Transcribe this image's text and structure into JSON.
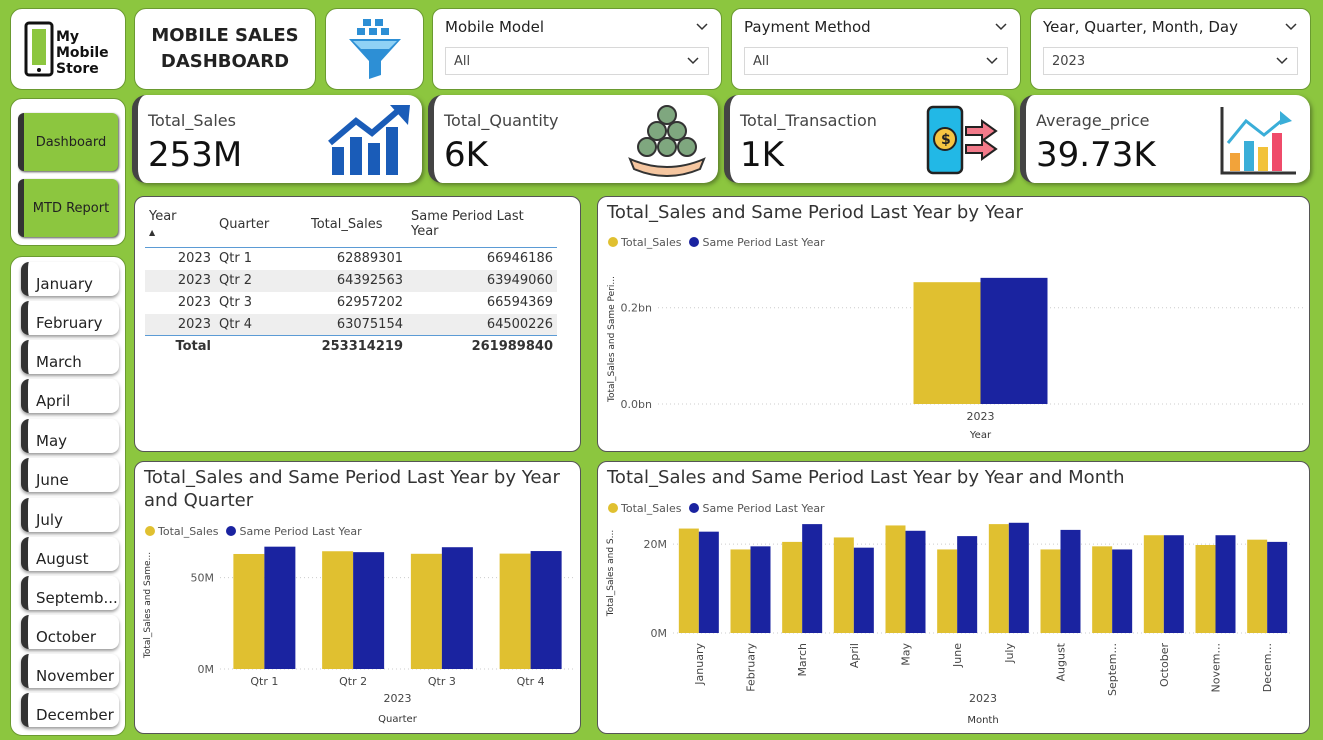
{
  "logo": {
    "line1": "My",
    "line2": "Mobile",
    "line3": "Store"
  },
  "title": {
    "line1": "MOBILE SALES",
    "line2": "DASHBOARD"
  },
  "slicers": [
    {
      "label": "Mobile Model",
      "value": "All"
    },
    {
      "label": "Payment Method",
      "value": "All"
    },
    {
      "label": "Year, Quarter, Month, Day",
      "value": "2023"
    }
  ],
  "nav": {
    "dashboard": "Dashboard",
    "mtd": "MTD Report"
  },
  "months": [
    "January",
    "February",
    "March",
    "April",
    "May",
    "June",
    "July",
    "August",
    "Septemb...",
    "October",
    "November",
    "December"
  ],
  "kpis": [
    {
      "label": "Total_Sales",
      "value": "253M",
      "icon": "growth-chart-icon"
    },
    {
      "label": "Total_Quantity",
      "value": "6K",
      "icon": "coins-hand-icon"
    },
    {
      "label": "Total_Transaction",
      "value": "1K",
      "icon": "mobile-payment-icon"
    },
    {
      "label": "Average_price",
      "value": "39.73K",
      "icon": "bar-chart-icon"
    }
  ],
  "matrix": {
    "headers": [
      "Year",
      "Quarter",
      "Total_Sales",
      "Same Period Last Year"
    ],
    "rows": [
      {
        "year": "2023",
        "quarter": "Qtr 1",
        "sales": "62889301",
        "last": "66946186"
      },
      {
        "year": "2023",
        "quarter": "Qtr 2",
        "sales": "64392563",
        "last": "63949060"
      },
      {
        "year": "2023",
        "quarter": "Qtr 3",
        "sales": "62957202",
        "last": "66594369"
      },
      {
        "year": "2023",
        "quarter": "Qtr 4",
        "sales": "63075154",
        "last": "64500226"
      }
    ],
    "total": {
      "label": "Total",
      "sales": "253314219",
      "last": "261989840"
    }
  },
  "colors": {
    "sales": "#e0c030",
    "last": "#1a23a0",
    "bg": "#8cc63f"
  },
  "chart_data": [
    {
      "type": "bar",
      "title": "Total_Sales and Same Period Last Year by Year",
      "legend": [
        "Total_Sales",
        "Same Period Last Year"
      ],
      "xlabel": "Year",
      "ylabel": "Total_Sales and Same Peri...",
      "categories": [
        "2023"
      ],
      "series": [
        {
          "name": "Total_Sales",
          "values": [
            0.253
          ]
        },
        {
          "name": "Same Period Last Year",
          "values": [
            0.262
          ]
        }
      ],
      "ylim": [
        0,
        0.27
      ],
      "yticks": [
        "0.0bn",
        "0.2bn"
      ]
    },
    {
      "type": "bar",
      "title": "Total_Sales and Same Period Last Year by Year and Quarter",
      "legend": [
        "Total_Sales",
        "Same Period Last Year"
      ],
      "xlabel": "Quarter",
      "xsublabel": "2023",
      "ylabel": "Total_Sales and Same...",
      "categories": [
        "Qtr 1",
        "Qtr 2",
        "Qtr 3",
        "Qtr 4"
      ],
      "series": [
        {
          "name": "Total_Sales",
          "values": [
            62.9,
            64.4,
            63.0,
            63.1
          ]
        },
        {
          "name": "Same Period Last Year",
          "values": [
            66.9,
            63.9,
            66.6,
            64.5
          ]
        }
      ],
      "ylim": [
        0,
        70
      ],
      "yticks": [
        "0M",
        "50M"
      ]
    },
    {
      "type": "bar",
      "title": "Total_Sales and Same Period Last Year by Year and Month",
      "legend": [
        "Total_Sales",
        "Same Period Last Year"
      ],
      "xlabel": "Month",
      "xsublabel": "2023",
      "ylabel": "Total_Sales and S...",
      "categories": [
        "January",
        "February",
        "March",
        "April",
        "May",
        "June",
        "July",
        "August",
        "Septem...",
        "October",
        "Novem...",
        "Decem..."
      ],
      "series": [
        {
          "name": "Total_Sales",
          "values": [
            23.5,
            18.8,
            20.5,
            21.5,
            24.2,
            18.8,
            24.5,
            18.8,
            19.5,
            22.0,
            19.8,
            21.0
          ]
        },
        {
          "name": "Same Period Last Year",
          "values": [
            22.8,
            19.5,
            24.5,
            19.2,
            23.0,
            21.8,
            24.8,
            23.2,
            18.8,
            22.0,
            22.0,
            20.5
          ]
        }
      ],
      "ylim": [
        0,
        27
      ],
      "yticks": [
        "0M",
        "20M"
      ]
    }
  ]
}
